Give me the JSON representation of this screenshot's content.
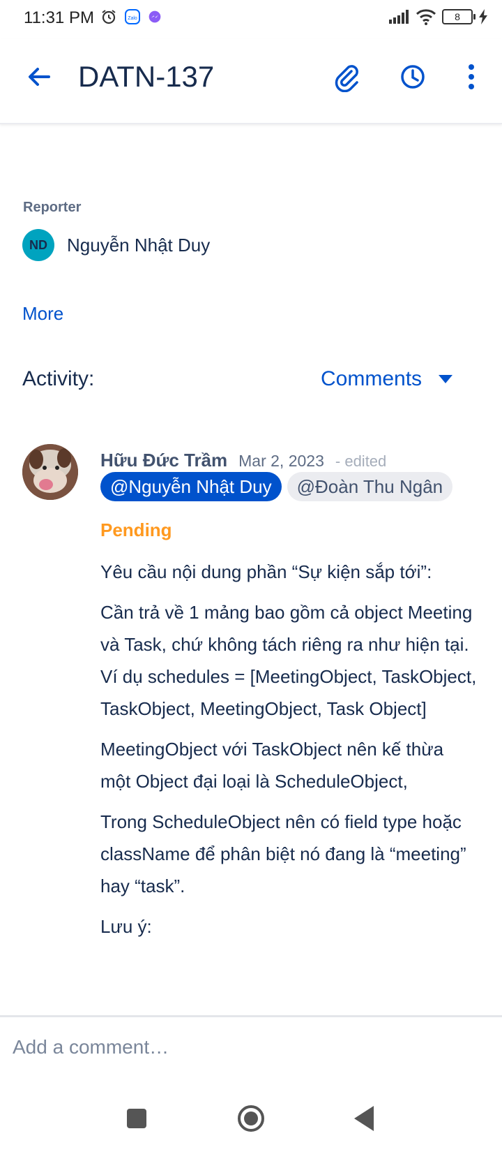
{
  "status_bar": {
    "time": "11:31 PM",
    "battery": "8",
    "icons_left": [
      "alarm-icon",
      "zalo-icon",
      "messenger-icon"
    ],
    "icons_right": [
      "signal-icon",
      "wifi-icon",
      "battery-icon",
      "charging-icon"
    ]
  },
  "header": {
    "title": "DATN-137",
    "icons": [
      "back-arrow-icon",
      "paperclip-icon",
      "clock-icon",
      "more-vertical-icon"
    ],
    "accent_color": "#0052cc"
  },
  "reporter": {
    "label": "Reporter",
    "initials": "ND",
    "name": "Nguyễn Nhật Duy",
    "avatar_color": "#00a3bf"
  },
  "more_link": "More",
  "activity": {
    "label": "Activity:",
    "filter": "Comments"
  },
  "comment": {
    "author": "Hữu Đức Trầm",
    "date": "Mar 2, 2023",
    "edited": "- edited",
    "mentions": [
      "@Nguyễn Nhật Duy",
      "@Đoàn Thu Ngân"
    ],
    "status": "Pending",
    "status_color": "#ff991f",
    "paragraphs": [
      "Yêu cầu nội dung phần “Sự kiện sắp tới”:",
      "Cần trả về 1 mảng bao gồm cả object Meeting và Task, chứ không tách riêng ra như hiện tại.",
      "Ví dụ schedules = [MeetingObject, TaskObject, TaskObject, MeetingObject, Task Object]",
      "MeetingObject với TaskObject nên kế thừa một Object đại loại là ScheduleObject,",
      "Trong ScheduleObject nên có field type hoặc className để phân biệt nó đang là “meeting” hay “task”.",
      "Lưu ý:"
    ]
  },
  "add_comment": {
    "placeholder": "Add a comment…"
  },
  "nav": {
    "icons": [
      "recents-icon",
      "home-icon",
      "back-icon"
    ]
  }
}
